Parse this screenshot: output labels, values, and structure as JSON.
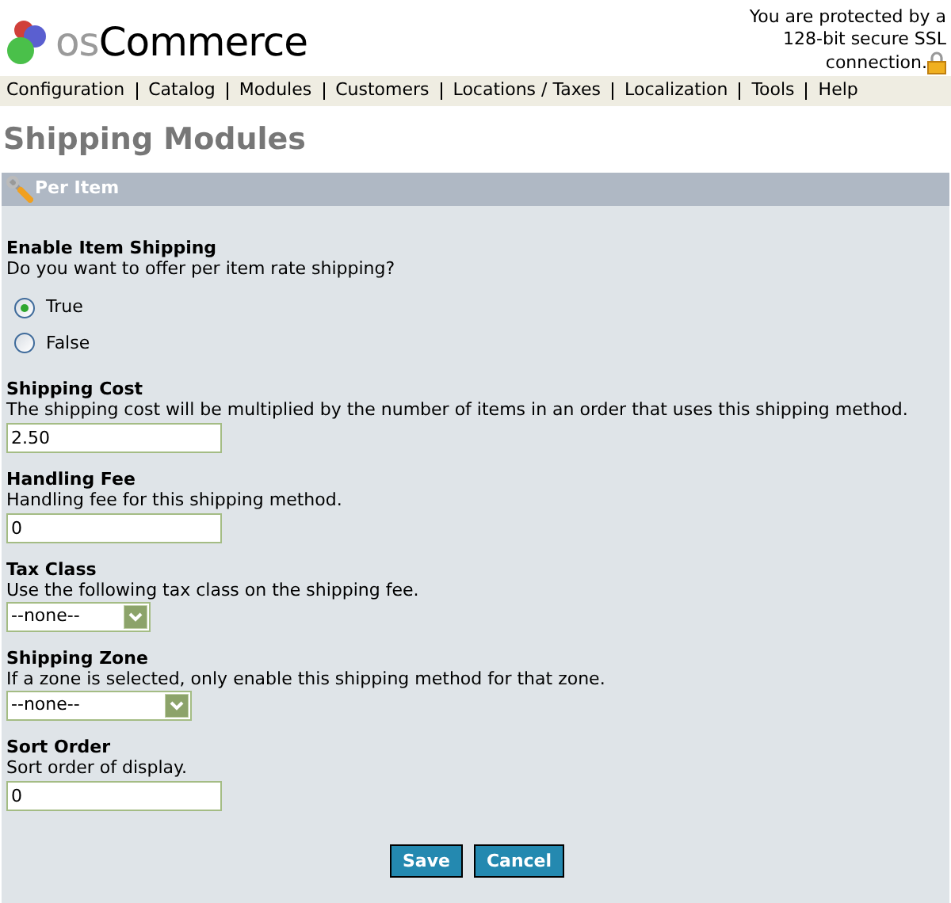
{
  "header": {
    "logo_prefix": "os",
    "logo_name": "Commerce",
    "ssl_notice": [
      "You are protected by a",
      "128-bit secure SSL",
      "connection."
    ]
  },
  "menu": [
    "Configuration",
    "Catalog",
    "Modules",
    "Customers",
    "Locations / Taxes",
    "Localization",
    "Tools",
    "Help"
  ],
  "page_title": "Shipping Modules",
  "panel": {
    "title": "Per Item",
    "fields": [
      {
        "kind": "radio",
        "label": "Enable Item Shipping",
        "description": "Do you want to offer per item rate shipping?",
        "options": [
          {
            "label": "True",
            "selected": true
          },
          {
            "label": "False",
            "selected": false
          }
        ]
      },
      {
        "kind": "text",
        "label": "Shipping Cost",
        "description": "The shipping cost will be multiplied by the number of items in an order that uses this shipping method.",
        "value": "2.50"
      },
      {
        "kind": "text",
        "label": "Handling Fee",
        "description": "Handling fee for this shipping method.",
        "value": "0"
      },
      {
        "kind": "select",
        "label": "Tax Class",
        "description": "Use the following tax class on the shipping fee.",
        "value": "--none--"
      },
      {
        "kind": "select",
        "label": "Shipping Zone",
        "description": "If a zone is selected, only enable this shipping method for that zone.",
        "value": "--none--"
      },
      {
        "kind": "text",
        "label": "Sort Order",
        "description": "Sort order of display.",
        "value": "0"
      }
    ],
    "buttons": [
      "Save",
      "Cancel"
    ]
  }
}
